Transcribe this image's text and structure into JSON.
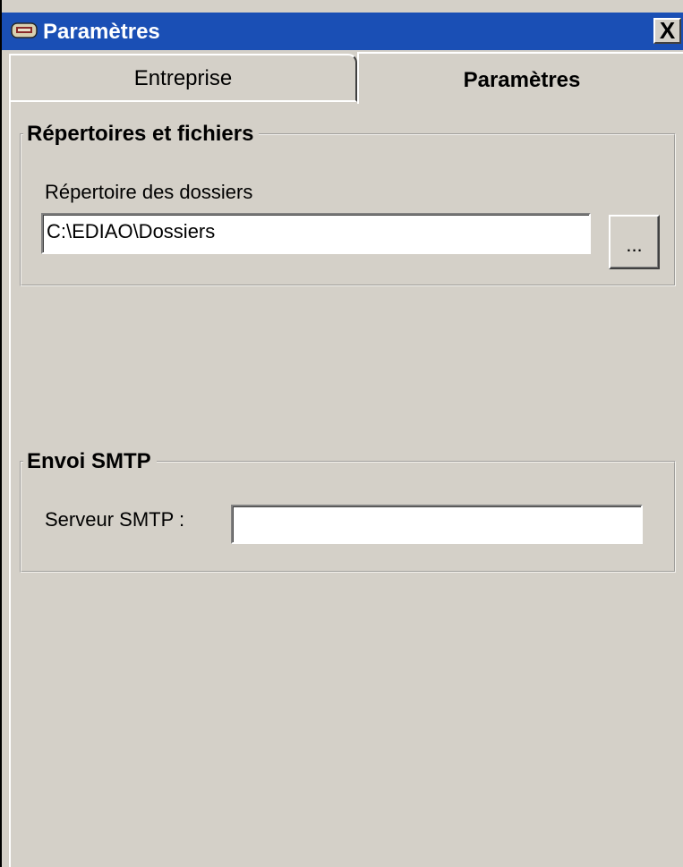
{
  "window": {
    "title": "Paramètres",
    "close_label": "X"
  },
  "tabs": [
    {
      "label": "Entreprise",
      "selected": false
    },
    {
      "label": "Paramètres",
      "selected": true
    }
  ],
  "directories_group": {
    "title": "Répertoires et fichiers",
    "folder_label": "Répertoire des dossiers",
    "folder_value": "C:\\EDIAO\\Dossiers",
    "browse_label": "..."
  },
  "smtp_group": {
    "title": "Envoi SMTP",
    "server_label": "Serveur SMTP :",
    "server_value": ""
  },
  "colors": {
    "titlebar": "#1a4fb5",
    "face": "#d4d0c8"
  }
}
